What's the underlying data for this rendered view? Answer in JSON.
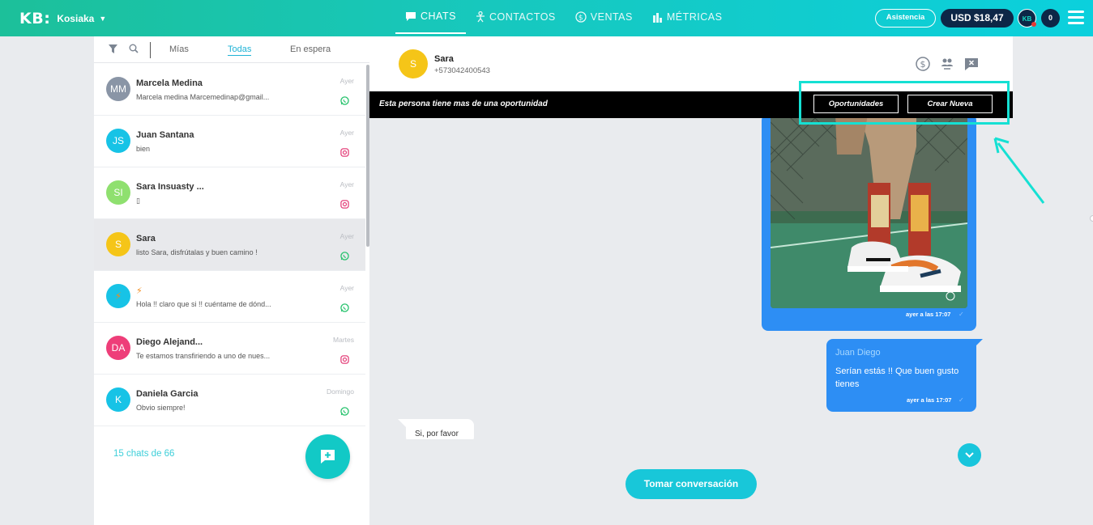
{
  "brand": {
    "logo": "KB:",
    "workspace": "Kosiaka"
  },
  "nav": [
    {
      "label": "CHATS",
      "icon": "chat-bubble-icon",
      "active": true
    },
    {
      "label": "CONTACTOS",
      "icon": "person-icon",
      "active": false
    },
    {
      "label": "VENTAS",
      "icon": "dollar-circle-icon",
      "active": false
    },
    {
      "label": "MÉTRICAS",
      "icon": "bar-chart-icon",
      "active": false
    }
  ],
  "topbar": {
    "assist_label": "Asistencia",
    "balance": "USD $18,47",
    "avatar_initials": "KB",
    "notifications": "0"
  },
  "filters": {
    "tabs": [
      "Mías",
      "Todas",
      "En espera"
    ],
    "active": "Todas"
  },
  "chats": [
    {
      "initials": "MM",
      "name": "Marcela Medina",
      "preview": "Marcela medina Marcemedinap@gmail...",
      "time": "Ayer",
      "channel": "whatsapp",
      "color": "#8a95a6"
    },
    {
      "initials": "JS",
      "name": "Juan Santana",
      "preview": "bien",
      "time": "Ayer",
      "channel": "instagram",
      "color": "#17c3e6"
    },
    {
      "initials": "SI",
      "name": "Sara Insuasty ...",
      "preview": "▯",
      "time": "Ayer",
      "channel": "instagram",
      "color": "#8fe06f"
    },
    {
      "initials": "S",
      "name": "Sara",
      "preview": "listo Sara, disfrútalas y buen camino !",
      "time": "Ayer",
      "channel": "whatsapp",
      "color": "#f5c518"
    },
    {
      "initials": "⚡",
      "name": "⚡",
      "preview": "Hola !! claro que si !! cuéntame de dónd...",
      "time": "Ayer",
      "channel": "whatsapp",
      "color": "#17c3e6"
    },
    {
      "initials": "DA",
      "name": "Diego Alejand...",
      "preview": "Te estamos transfiriendo a uno de nues...",
      "time": "Martes",
      "channel": "instagram",
      "color": "#ee3e79"
    },
    {
      "initials": "K",
      "name": "Daniela Garcia",
      "preview": "Obvio siempre!",
      "time": "Domingo",
      "channel": "whatsapp",
      "color": "#17c3e6"
    }
  ],
  "chat_count": "15 chats de 66",
  "conversation": {
    "contact_initial": "S",
    "contact_name": "Sara",
    "contact_phone": "+573042400543",
    "opportunity_text": "Esta persona tiene mas de una oportunidad",
    "opportunities_label": "Oportunidades",
    "create_new_label": "Crear Nueva",
    "messages": {
      "image_time": "ayer a las 17:07",
      "sender": "Juan Diego",
      "text": "Serían estás !! Que buen gusto tienes",
      "text_time": "ayer a las 17:07",
      "incoming": "Si, por favor"
    },
    "take_label": "Tomar conversación"
  }
}
